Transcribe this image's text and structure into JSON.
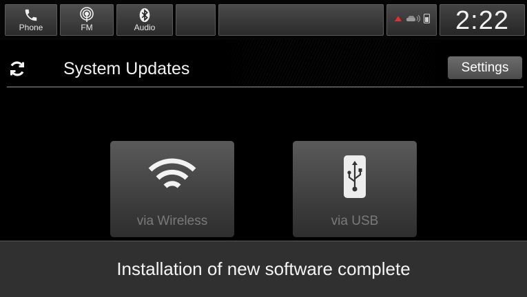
{
  "status_bar": {
    "sources": [
      {
        "label": "Phone",
        "icon": "phone-icon"
      },
      {
        "label": "FM",
        "icon": "radio-antenna-icon"
      },
      {
        "label": "Audio",
        "icon": "bluetooth-icon"
      }
    ],
    "status_icons": [
      "connectivity-status-icon",
      "vehicle-signal-icon",
      "phone-battery-icon"
    ],
    "time": "2:22"
  },
  "header": {
    "title": "System Updates",
    "icon": "refresh-icon",
    "settings_label": "Settings"
  },
  "options": [
    {
      "label": "via Wireless",
      "icon": "wifi-icon",
      "enabled": false
    },
    {
      "label": "via USB",
      "icon": "usb-icon",
      "enabled": false
    }
  ],
  "message": "Installation of new software complete",
  "colors": {
    "background": "#000000",
    "tile": "#3a3a3a",
    "disabled_text": "#7a7a7a",
    "message_bar": "#303030",
    "status_red": "#e03030"
  }
}
